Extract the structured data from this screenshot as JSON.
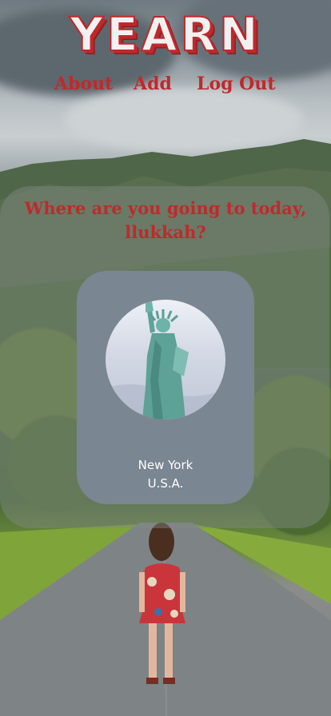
{
  "app": {
    "logo_text": "YEARN",
    "brand_color": "#c0292b"
  },
  "nav": {
    "about_label": "About",
    "add_label": "Add",
    "logout_label": "Log Out"
  },
  "main": {
    "greeting": "Where are you going to today, llukkah?",
    "destination": {
      "city": "New York",
      "country": "U.S.A.",
      "image_icon": "statue-of-liberty-icon"
    }
  }
}
